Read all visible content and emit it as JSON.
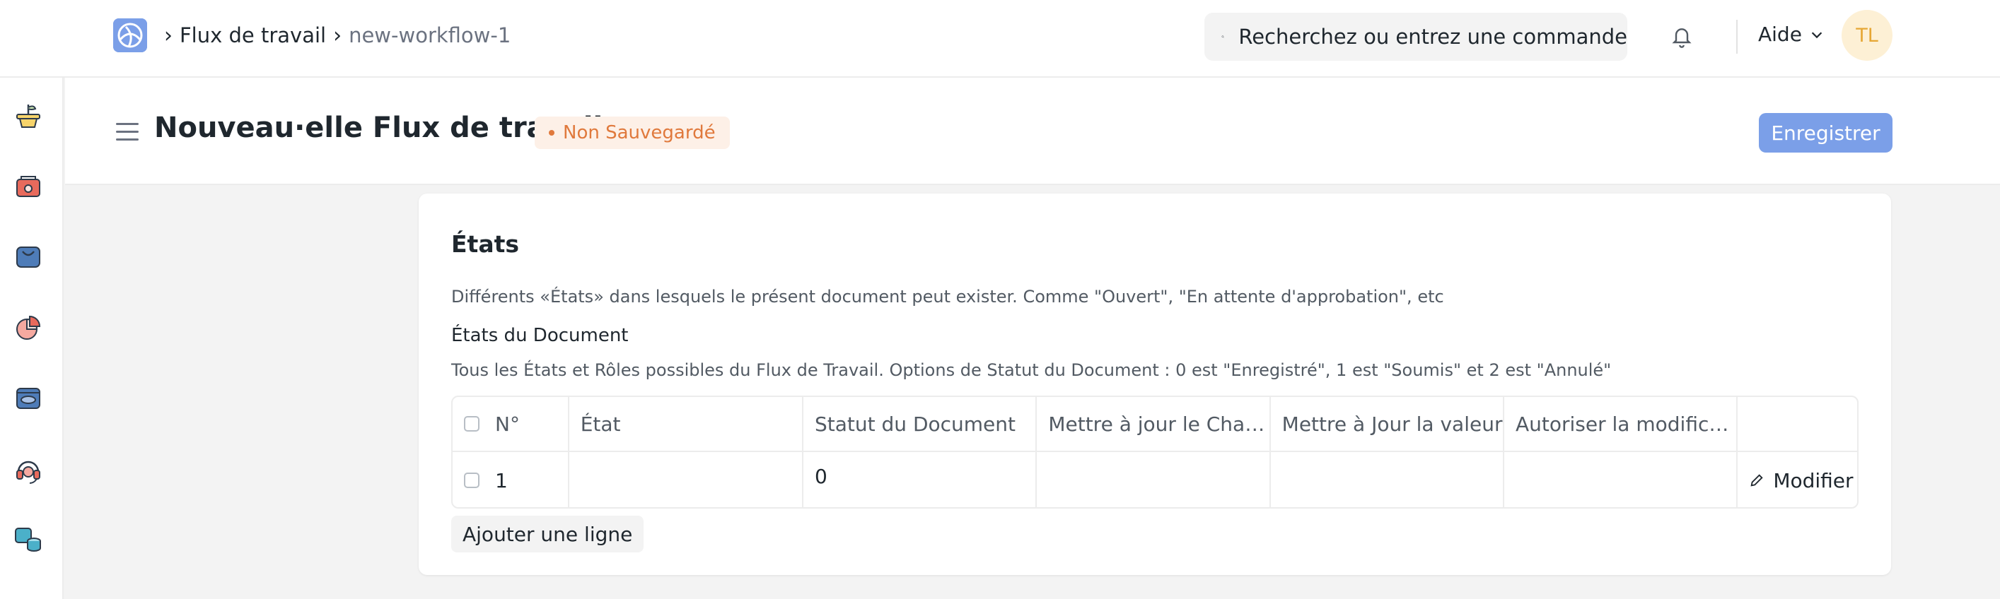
{
  "navbar": {
    "breadcrumbs": [
      {
        "label": "Flux de travail"
      },
      {
        "label": "new-workflow-1"
      }
    ],
    "search_placeholder": "Recherchez ou entrez une commande",
    "help_label": "Aide",
    "avatar_initials": "TL"
  },
  "sidebar": {
    "icons": [
      "plant-pot-icon",
      "camera-box-icon",
      "shopping-bag-icon",
      "pie-chart-icon",
      "tray-icon",
      "support-agent-icon",
      "database-icon"
    ]
  },
  "page": {
    "title": "Nouveau·elle Flux de travail",
    "status_badge": "Non Sauvegardé",
    "save_label": "Enregistrer"
  },
  "section": {
    "title": "États",
    "description": "Différents «États» dans lesquels le présent document peut exister. Comme \"Ouvert\", \"En attente d'approbation\", etc",
    "field_label": "États du Document",
    "field_description": "Tous les États et Rôles possibles du Flux de Travail. Options de Statut du Document : 0 est \"Enregistré\", 1 est \"Soumis\" et 2 est \"Annulé\"",
    "table": {
      "columns": [
        "N°",
        "État",
        "Statut du Document",
        "Mettre à jour le Cha…",
        "Mettre à Jour la valeur",
        "Autoriser la modific…",
        ""
      ],
      "rows": [
        {
          "idx": "1",
          "state": "",
          "doc_status": "0",
          "update_field": "",
          "update_value": "",
          "allow_edit": "",
          "action": "Modifier"
        }
      ]
    },
    "add_row_label": "Ajouter une ligne"
  },
  "colors": {
    "accent": "#7b9fe8",
    "badge_text": "#e0793c",
    "badge_bg": "#fdf0e7",
    "avatar_bg": "#fdf0d5",
    "avatar_text": "#e6a735"
  }
}
